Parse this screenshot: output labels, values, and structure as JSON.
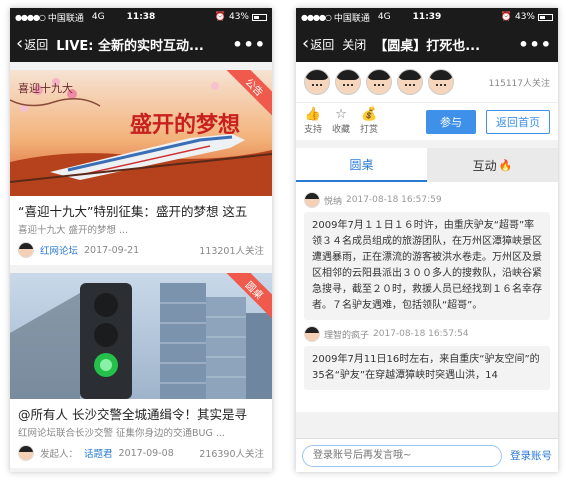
{
  "left": {
    "status": {
      "carrier": "中国联通",
      "network": "4G",
      "time": "11:38",
      "battery": "43%"
    },
    "nav": {
      "back_label": "返回",
      "title": "LIVE: 全新的实时互动...",
      "more": "•••"
    },
    "posts": [
      {
        "badge": "公告",
        "banner_caption": "喜迎十九大",
        "banner_headline": "盛开的梦想",
        "title": "“喜迎十九大”特别征集：盛开的梦想 这五",
        "subtitle": "喜迎十九大 盛开的梦想 ...",
        "author": "红网论坛",
        "date": "2017-09-21",
        "follows": "113201人关注"
      },
      {
        "badge": "圆桌",
        "title": "@所有人 长沙交警全城通缉令！其实是寻",
        "subtitle": "红网论坛联合长沙交警 征集你身边的交通BUG ...",
        "author_prefix": "发起人：",
        "author": "话题君",
        "date": "2017-09-08",
        "follows": "216390人关注"
      }
    ]
  },
  "right": {
    "status": {
      "carrier": "中国联通",
      "network": "4G",
      "time": "11:39",
      "battery": "43%"
    },
    "nav": {
      "back_label": "返回",
      "close_label": "关闭",
      "title": "【圆桌】打死也...",
      "more": "•••"
    },
    "follows": "115117人关注",
    "actions": {
      "support": "支持",
      "favorite": "收藏",
      "tip": "打赏",
      "join": "参与",
      "home": "返回首页"
    },
    "tabs": {
      "roundtable": "圆桌",
      "interact": "互动"
    },
    "messages": [
      {
        "user": "悦纳",
        "time": "2017-08-18 16:57:59",
        "text": "2009年7月１１日１６时许，由重庆驴友“超哥”率领３４名成员组成的旅游团队，在万州区潭獐峡景区遭遇暴雨，正在漂流的游客被洪水卷走。万州区及景区相邻的云阳县派出３００多人的搜救队，沿峡谷紧急搜寻，截至２０时，救援人员已经找到１６名幸存者。７名驴友遇难，包括领队“超哥”。"
      },
      {
        "user": "理智的疯子",
        "time": "2017-08-18 16:57:54",
        "text": "2009年7月11日16时左右，来自重庆“驴友空间”的35名“驴友”在穿越潭獐峡时突遇山洪，14"
      }
    ],
    "input": {
      "placeholder": "登录账号后再发言哦~",
      "login": "登录账号"
    }
  }
}
